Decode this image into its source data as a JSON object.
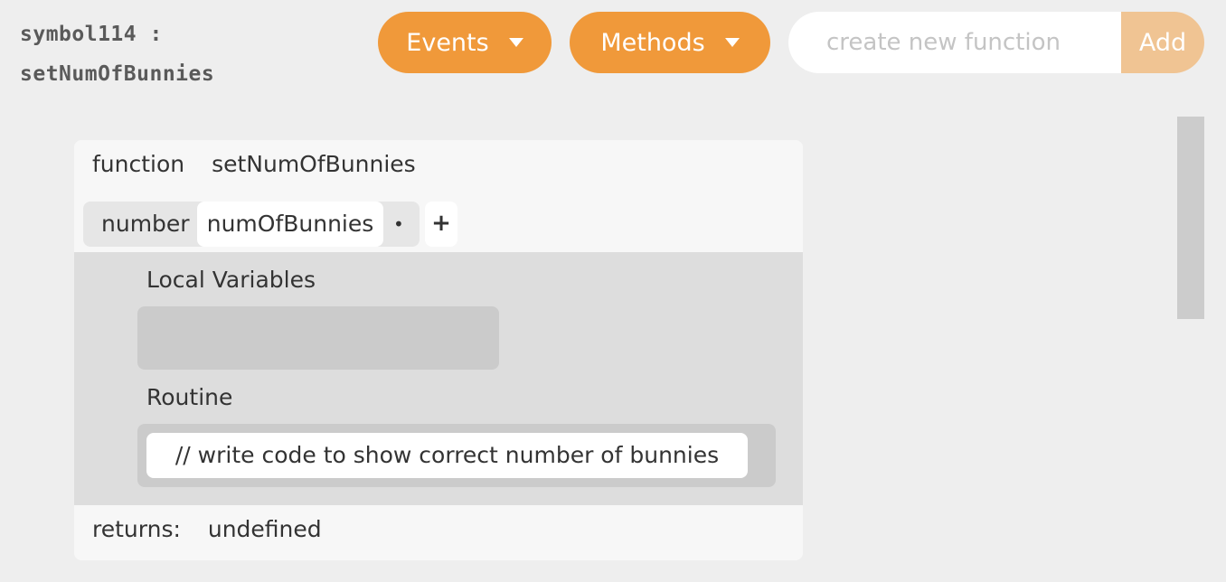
{
  "header": {
    "symbol_label": "symbol114 :",
    "function_name": "setNumOfBunnies"
  },
  "toolbar": {
    "events_label": "Events",
    "methods_label": "Methods",
    "new_function_placeholder": "create new function",
    "add_label": "Add"
  },
  "function": {
    "keyword": "function",
    "name": "setNumOfBunnies",
    "params": [
      {
        "type": "number",
        "name": "numOfBunnies",
        "marker": "•"
      }
    ],
    "add_param_label": "+",
    "local_variables_label": "Local Variables",
    "routine_label": "Routine",
    "routine_lines": [
      "// write code to show correct number of bunnies"
    ],
    "returns_label": "returns:",
    "returns_value": "undefined"
  },
  "colors": {
    "accent": "#f0993a",
    "accent_disabled": "#f0c493",
    "background": "#eeeeee",
    "card": "#f7f7f7",
    "body_area": "#dddddd"
  },
  "icons": {
    "dropdown": "caret-down-icon"
  }
}
